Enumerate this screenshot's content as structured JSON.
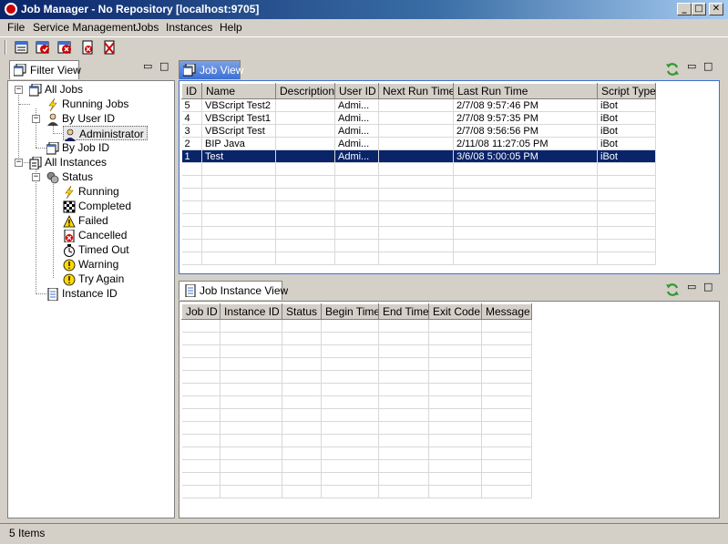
{
  "window": {
    "title": "Job Manager - No Repository [localhost:9705]",
    "buttons": {
      "minimize": "_",
      "maximize": "□",
      "close": "✕"
    }
  },
  "menu": [
    {
      "label": "File",
      "accel": "F"
    },
    {
      "label": "Service Management",
      "accel": "S"
    },
    {
      "label": "Jobs",
      "accel": "J"
    },
    {
      "label": "Instances",
      "accel": "I"
    },
    {
      "label": "Help",
      "accel": "H"
    }
  ],
  "toolbar": {
    "icons": [
      "job-instance-icon",
      "run-job-icon",
      "delete-job-icon",
      "cancel-instance-icon",
      "delete-instance-icon"
    ]
  },
  "filter_view": {
    "tab_label": "Filter View",
    "tree": {
      "all_jobs": "All Jobs",
      "running_jobs": "Running Jobs",
      "by_user_id": "By User ID",
      "administrator": "Administrator",
      "by_job_id": "By Job ID",
      "all_instances": "All Instances",
      "status": "Status",
      "running": "Running",
      "completed": "Completed",
      "failed": "Failed",
      "cancelled": "Cancelled",
      "timed_out": "Timed Out",
      "warning": "Warning",
      "try_again": "Try Again",
      "instance_id": "Instance ID"
    }
  },
  "job_view": {
    "tab_label": "Job View",
    "columns": [
      "ID",
      "Name",
      "Description",
      "User ID",
      "Next Run Time",
      "Last Run Time",
      "Script Type"
    ],
    "rows": [
      [
        "5",
        "VBScript Test2",
        "",
        "Admi...",
        "",
        "2/7/08 9:57:46 PM",
        "iBot"
      ],
      [
        "4",
        "VBScript Test1",
        "",
        "Admi...",
        "",
        "2/7/08 9:57:35 PM",
        "iBot"
      ],
      [
        "3",
        "VBScript Test",
        "",
        "Admi...",
        "",
        "2/7/08 9:56:56 PM",
        "iBot"
      ],
      [
        "2",
        "BIP Java",
        "",
        "Admi...",
        "",
        "2/11/08 11:27:05 PM",
        "iBot"
      ],
      [
        "1",
        "Test",
        "",
        "Admi...",
        "",
        "3/6/08 5:00:05 PM",
        "iBot"
      ]
    ],
    "selected_row": 4
  },
  "job_instance_view": {
    "tab_label": "Job Instance View",
    "columns": [
      "Job ID",
      "Instance ID",
      "Status",
      "Begin Time",
      "End Time",
      "Exit Code",
      "Message"
    ],
    "rows": []
  },
  "status_bar": {
    "text": "5 Items"
  },
  "colors": {
    "title_start": "#0a246a",
    "selection": "#0a246a",
    "refresh_green": "#2e9a2e",
    "tab_blue": "#3c6fd2"
  }
}
